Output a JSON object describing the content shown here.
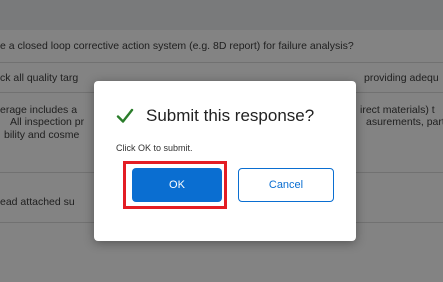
{
  "background_rows": [
    "e a closed loop corrective action system (e.g. 8D report) for failure analysis?",
    "ck all quality targ",
    "erage includes a",
    "All inspection pr",
    "bility and cosme",
    "ead attached su"
  ],
  "background_right_fragments": [
    "providing adequ",
    "irect materials) t",
    "asurements, part"
  ],
  "dialog": {
    "icon": "check-icon",
    "icon_color": "#2b7d2b",
    "title": "Submit this response?",
    "message": "Click OK to submit.",
    "ok_label": "OK",
    "cancel_label": "Cancel",
    "highlight_color": "#e31d24"
  }
}
